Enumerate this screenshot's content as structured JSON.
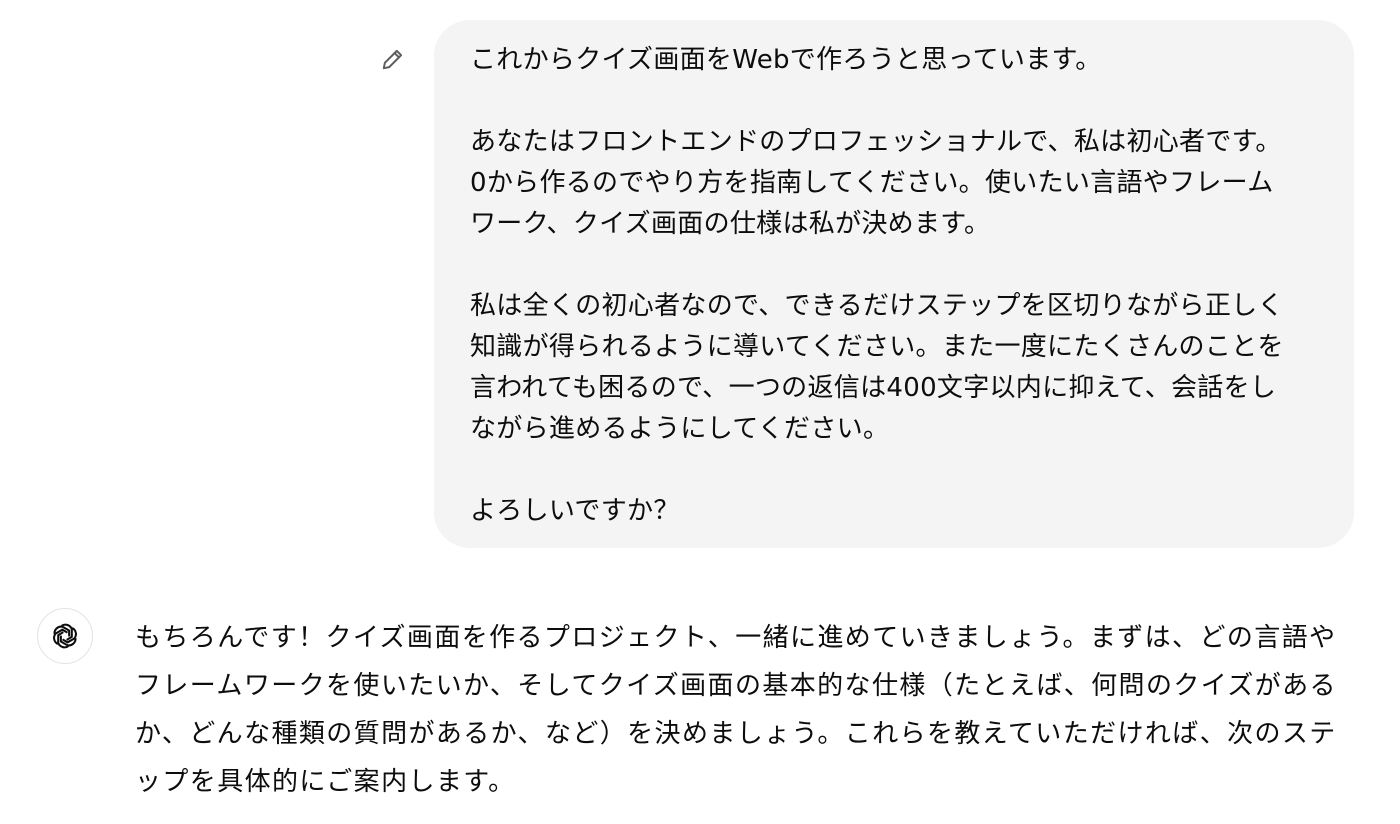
{
  "user_message": {
    "text": "これからクイズ画面をWebで作ろうと思っています。\n\nあなたはフロントエンドのプロフェッショナルで、私は初心者です。\n0から作るのでやり方を指南してください。使いたい言語やフレーム\nワーク、クイズ画面の仕様は私が決めます。\n\n私は全くの初心者なので、できるだけステップを区切りながら正しく\n知識が得られるように導いてください。また一度にたくさんのことを\n言われても困るので、一つの返信は400文字以内に抑えて、会話をし\nながら進めるようにしてください。\n\nよろしいですか？",
    "edit_icon": "pencil-icon"
  },
  "assistant_message": {
    "avatar_icon": "openai-logo-icon",
    "text": "もちろんです！クイズ画面を作るプロジェクト、一緒に進めていきましょう。まずは、どの言語やフレームワークを使いたいか、そしてクイズ画面の基本的な仕様（たとえば、何問のクイズがあるか、どんな種類の質問があるか、など）を決めましょう。これらを教えていただければ、次のステップを具体的にご案内します。"
  },
  "colors": {
    "user_bubble_bg": "#f4f4f4",
    "text": "#0d0d0d",
    "icon": "#5d5d5d"
  }
}
